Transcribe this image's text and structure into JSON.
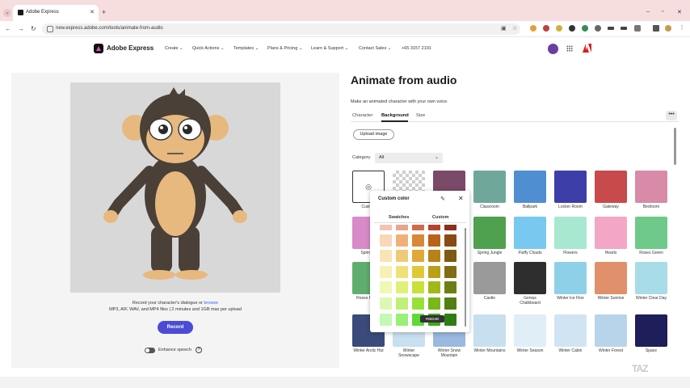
{
  "browser": {
    "tab_title": "Adobe Express",
    "url": "new.express.adobe.com/tools/animate-from-audio"
  },
  "header": {
    "brand": "Adobe Express",
    "nav": [
      "Create",
      "Quick Actions",
      "Templates",
      "Plans & Pricing",
      "Learn & Support",
      "Contact Sales",
      "+65 3157 2191"
    ]
  },
  "preview": {
    "hint_line1_prefix": "Record your character's dialogue or ",
    "hint_link": "browse",
    "hint_line2": "MP3, AIF, WAV, and MP4 files | 2 minutes and 1GB max per upload",
    "record_label": "Record",
    "enhance_label": "Enhance speech",
    "enhance_on": false
  },
  "panel": {
    "title": "Animate from audio",
    "subtitle": "Make an animated character with your own voice.",
    "tabs": [
      "Character",
      "Background",
      "Size"
    ],
    "active_tab": "Background",
    "upload_label": "Upload image",
    "category_label": "Category",
    "category_value": "All"
  },
  "backgrounds": [
    {
      "label": "Custom",
      "color": "#ffffff"
    },
    {
      "label": "",
      "color": "#e0e0e0"
    },
    {
      "label": "",
      "color": "#7a4a68"
    },
    {
      "label": "Classroom",
      "color": "#6fa89a"
    },
    {
      "label": "Ballpark",
      "color": "#4f8fd1"
    },
    {
      "label": "Locker Room",
      "color": "#3e3ea8"
    },
    {
      "label": "Gateway",
      "color": "#c94a4a"
    },
    {
      "label": "Bedroom",
      "color": "#d98aa8"
    },
    {
      "label": "Spring S",
      "color": "#d98ac8"
    },
    {
      "label": "",
      "color": "#ffffff"
    },
    {
      "label": "",
      "color": "#ffffff"
    },
    {
      "label": "Spring Jungle",
      "color": "#4fa04f"
    },
    {
      "label": "Fluffy Clouds",
      "color": "#78c8f0"
    },
    {
      "label": "Flowers",
      "color": "#a8e8d0"
    },
    {
      "label": "Hearts",
      "color": "#f4a6c6"
    },
    {
      "label": "Roses Green",
      "color": "#6fc98a"
    },
    {
      "label": "Roses Pi Gre",
      "color": "#5fae6f"
    },
    {
      "label": "",
      "color": "#ffffff"
    },
    {
      "label": "",
      "color": "#ffffff"
    },
    {
      "label": "Castle",
      "color": "#9a9a9a"
    },
    {
      "label": "Genius Chalkboard",
      "color": "#2e2e2e"
    },
    {
      "label": "Winter Ice Floe",
      "color": "#8ed0e8"
    },
    {
      "label": "Winter Sunrise",
      "color": "#e0906a"
    },
    {
      "label": "Winter Clear Day",
      "color": "#a8dce8"
    },
    {
      "label": "Winter Arctic Hut",
      "color": "#3a4a7a"
    },
    {
      "label": "Winter Snowscape",
      "color": "#c8e0f0"
    },
    {
      "label": "Winter Snow Mountain",
      "color": "#9ab8e0"
    },
    {
      "label": "Winter Mountains",
      "color": "#c8dff0"
    },
    {
      "label": "Winter Season",
      "color": "#e0eef8"
    },
    {
      "label": "Winter Cabin",
      "color": "#d0e4f4"
    },
    {
      "label": "Winter Forest",
      "color": "#b8d4ea"
    },
    {
      "label": "Space",
      "color": "#1e1e5a"
    }
  ],
  "popover": {
    "title": "Custom color",
    "tabs": [
      "Swatches",
      "Custom"
    ],
    "tooltip": "#56D4B",
    "swatch_rows": [
      [
        "#f2c4b4",
        "#e8a48c",
        "#cf6a4e",
        "#b8432e",
        "#8c2e1e"
      ],
      [
        "#f8d8b8",
        "#f0b07a",
        "#d88838",
        "#b86418",
        "#8a4a14"
      ],
      [
        "#f8e4b4",
        "#f0ca78",
        "#e0a838",
        "#b88218",
        "#7e5a14"
      ],
      [
        "#f8f0b4",
        "#f0e078",
        "#e0c838",
        "#b8a018",
        "#7e6e14"
      ],
      [
        "#f0f8b4",
        "#e0f078",
        "#c8e038",
        "#a0b818",
        "#6e7e14"
      ],
      [
        "#dcf8b4",
        "#c0f078",
        "#98e038",
        "#78b818",
        "#527e14"
      ],
      [
        "#c4f8b4",
        "#98f078",
        "#60d838",
        "#40a818",
        "#2e7e14"
      ],
      [
        "#b4f8c0",
        "#78f098",
        "#38d860",
        "#18a840",
        "#147e2e"
      ]
    ]
  },
  "watermark": "TAZ"
}
